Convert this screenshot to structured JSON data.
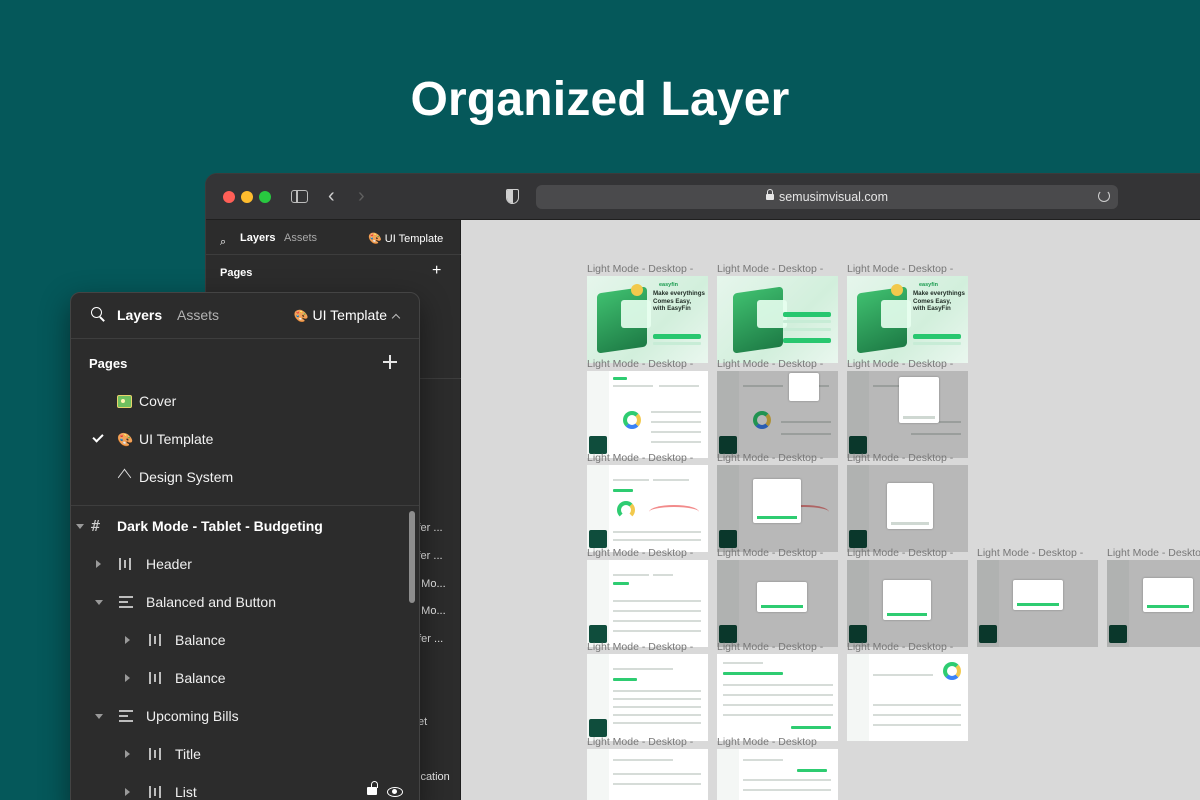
{
  "headline": "Organized Layer",
  "browser": {
    "url": "semusimvisual.com"
  },
  "bg_panel": {
    "tab_layers": "Layers",
    "tab_assets": "Assets",
    "page_switch": "UI Template",
    "pages_label": "Pages",
    "truncated_rows": [
      "sfer ...",
      "sfer ...",
      "e Mo...",
      "e Mo...",
      "nfer ...",
      "et",
      "ication"
    ]
  },
  "canvas": {
    "frame_label": "Light Mode - Desktop -",
    "frame_label_short": "Light Mode - Desktop",
    "frame_label_cut": "Light Mode - Deskto"
  },
  "layers_panel": {
    "tab_layers": "Layers",
    "tab_assets": "Assets",
    "page_switch": "UI Template",
    "pages_label": "Pages",
    "pages": [
      {
        "label": "Cover"
      },
      {
        "label": "UI Template"
      },
      {
        "label": "Design System"
      }
    ],
    "layers": [
      {
        "label": "Dark Mode - Tablet - Budgeting"
      },
      {
        "label": "Header"
      },
      {
        "label": "Balanced and Button"
      },
      {
        "label": "Balance"
      },
      {
        "label": "Balance"
      },
      {
        "label": "Upcoming Bills"
      },
      {
        "label": "Title"
      },
      {
        "label": "List"
      }
    ]
  },
  "thumbnail": {
    "cover_brand": "easyfin",
    "cover_title": "Make everythings Comes Easy, with EasyFin"
  },
  "colors": {
    "background": "#05585a",
    "panel": "#2c2c2c",
    "canvas": "#d9d9d9",
    "accent": "#2ecc71"
  }
}
